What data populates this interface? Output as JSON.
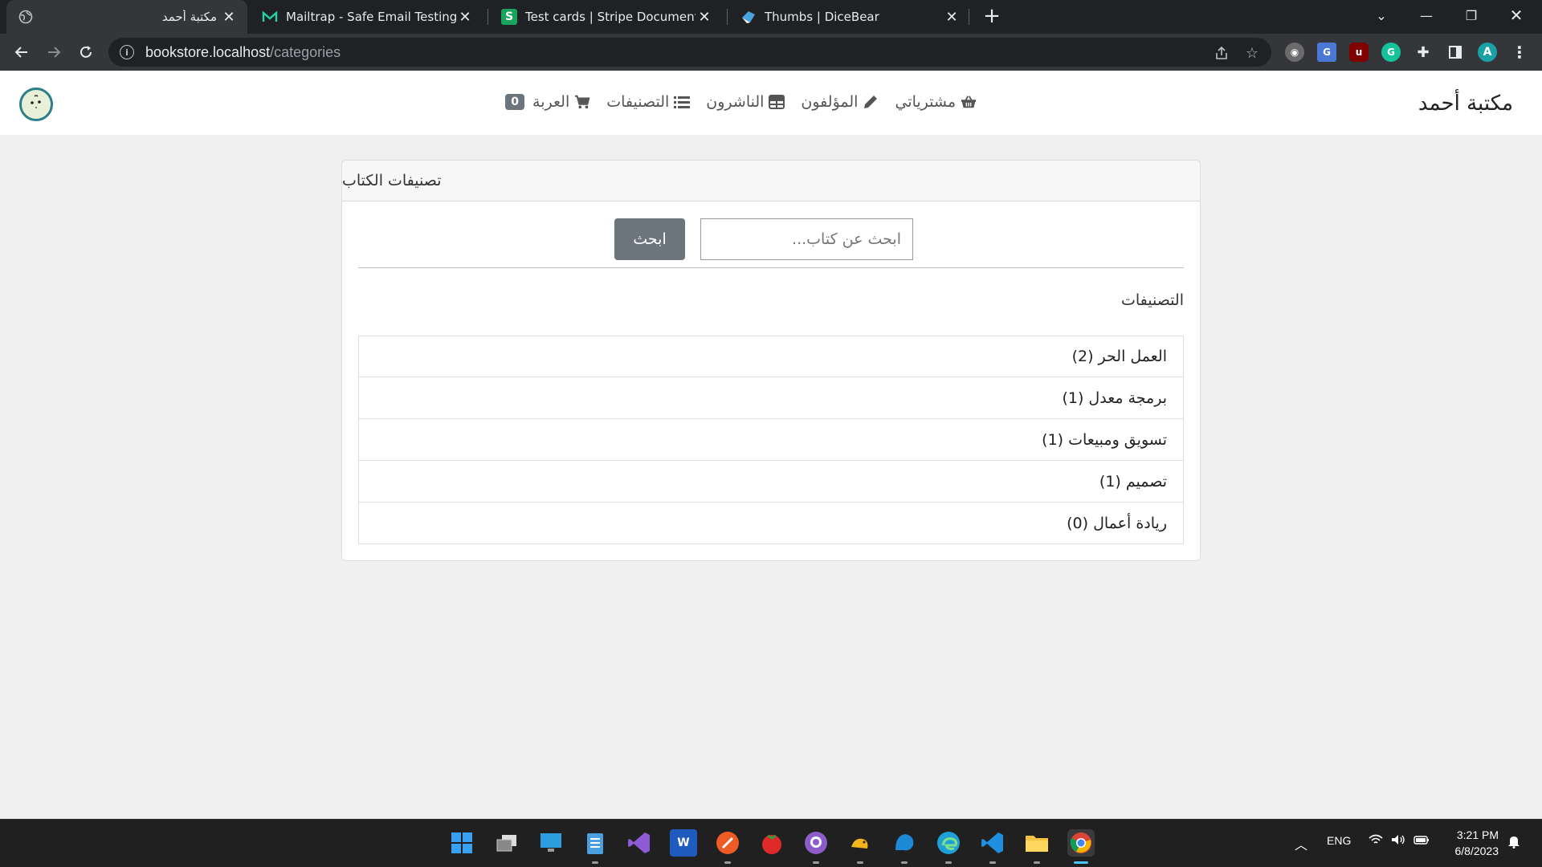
{
  "browser": {
    "tabs": [
      {
        "title": "مكتبة أحمد",
        "active": true
      },
      {
        "title": "Mailtrap - Safe Email Testing",
        "active": false
      },
      {
        "title": "Test cards | Stripe Documentation",
        "active": false
      },
      {
        "title": "Thumbs | DiceBear",
        "active": false
      }
    ],
    "url_host": "bookstore.localhost",
    "url_path": "/categories"
  },
  "site": {
    "brand": "مكتبة أحمد",
    "nav": {
      "cart_count": "0",
      "cart": "العربة",
      "categories": "التصنيفات",
      "publishers": "الناشرون",
      "authors": "المؤلفون",
      "purchases": "مشترياتي"
    }
  },
  "card": {
    "header": "تصنيفات الكتاب",
    "search_placeholder": "ابحث عن كتاب...",
    "search_button": "ابحث",
    "section_title": "التصنيفات",
    "categories": [
      {
        "label": "العمل الحر (2)"
      },
      {
        "label": "برمجة معدل (1)"
      },
      {
        "label": "تسويق ومبيعات (1)"
      },
      {
        "label": "تصميم (1)"
      },
      {
        "label": "ريادة أعمال (0)"
      }
    ]
  },
  "taskbar": {
    "lang": "ENG",
    "time": "3:21 PM",
    "date": "6/8/2023"
  }
}
